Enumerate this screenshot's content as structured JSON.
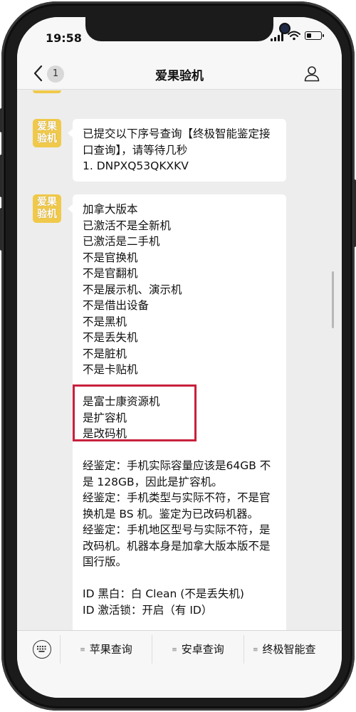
{
  "status_bar": {
    "time": "19:58",
    "battery_level": 0.3
  },
  "nav": {
    "unread_count": "1",
    "title": "爱果验机"
  },
  "sender": {
    "avatar_text": "爱果\n验机",
    "avatar_color": "#f0c94a"
  },
  "messages": [
    {
      "lines": [
        "已提交以下序号查询【终极智能鉴定接口查询】，请等待几秒",
        "1. DNPXQ53QKXKV"
      ]
    },
    {
      "lines": [
        "加拿大版本",
        "已激活不是全新机",
        "已激活是二手机",
        "不是官换机",
        "不是官翻机",
        "不是展示机、演示机",
        "不是借出设备",
        "不是黑机",
        "不是丢失机",
        "不是脏机",
        "不是卡贴机",
        "",
        "是富士康资源机",
        "是扩容机",
        "是改码机",
        "",
        "经鉴定：手机实际容量应该是64GB 不是 128GB，因此是扩容机。",
        "经鉴定：手机类型与实际不符，不是官换机是 BS 机。鉴定为已改码机器。",
        "经鉴定：手机地区型号与实际不符，是改码机。机器本身是加拿大版本版不是国行版。",
        "",
        "ID 黑白：白 Clean (不是丢失机)",
        "ID 激活锁：开启（有 ID）"
      ]
    }
  ],
  "menu": {
    "items": [
      {
        "label": "苹果查询"
      },
      {
        "label": "安卓查询"
      },
      {
        "label": "终极智能查"
      }
    ]
  },
  "colors": {
    "highlight_border": "#c8203c",
    "chat_background": "#ededed"
  }
}
